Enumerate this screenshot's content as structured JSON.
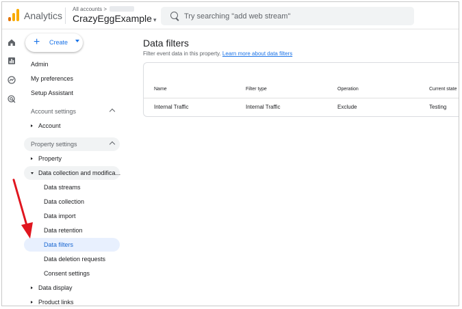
{
  "header": {
    "app_name": "Analytics",
    "account_crumb": "All accounts  >",
    "property_name": "CrazyEggExample",
    "search_placeholder": "Try searching \"add web stream\""
  },
  "rail": {
    "icons": [
      "home-icon",
      "reports-icon",
      "explore-icon",
      "advertising-icon"
    ]
  },
  "nav": {
    "create_label": "Create",
    "top_items": [
      "Admin",
      "My preferences",
      "Setup Assistant"
    ],
    "account_settings": {
      "label": "Account settings",
      "items": [
        "Account"
      ]
    },
    "property_settings": {
      "label": "Property settings",
      "items": [
        "Property",
        "Data collection and modifica..."
      ]
    },
    "data_collection_sub": [
      "Data streams",
      "Data collection",
      "Data import",
      "Data retention",
      "Data filters",
      "Data deletion requests",
      "Consent settings"
    ],
    "bottom_items": [
      "Data display",
      "Product links"
    ]
  },
  "main": {
    "title": "Data filters",
    "subtitle": "Filter event data in this property.",
    "learn_more": "Learn more about data filters",
    "columns": [
      "Name",
      "Filter type",
      "Operation",
      "Current state"
    ],
    "rows": [
      [
        "Internal Traffic",
        "Internal Traffic",
        "Exclude",
        "Testing"
      ]
    ]
  },
  "colors": {
    "brand_orange": "#f9ab00",
    "brand_orange_dark": "#e37400",
    "accent_blue": "#1a73e8",
    "active_bg": "#e8f0fe",
    "arrow_red": "#e0161f"
  }
}
